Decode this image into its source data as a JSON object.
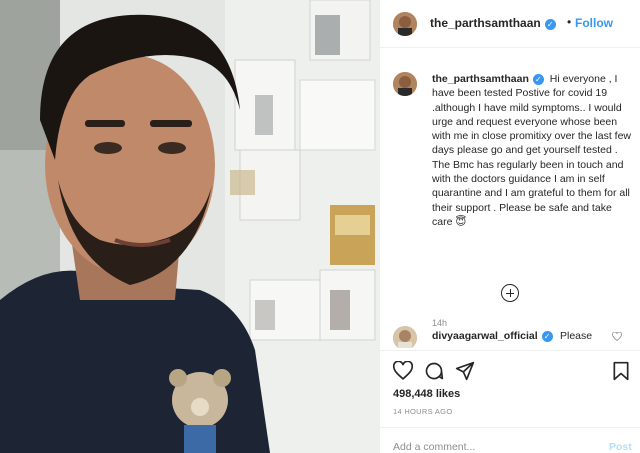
{
  "post": {
    "username": "the_parthsamthaan",
    "follow_label": "Follow",
    "header_separator": "•",
    "caption": "Hi everyone , I have been tested Postive for covid 19 .although I have mild symptoms.. I would urge and request everyone whose been with me in close promitixy over the last few days please go and get yourself tested . The Bmc has regularly been in touch and with the doctors guidance I am in self quarantine and I am grateful to them for all their support . Please be safe and take care",
    "caption_emoji": "😇",
    "caption_time": "14h",
    "likes": "498,448 likes",
    "time_ago": "14 HOURS AGO",
    "add_comment_placeholder": "Add a comment...",
    "post_label": "Post"
  },
  "comment": {
    "username": "divyaagarwal_official",
    "text": "Please"
  },
  "colors": {
    "accent": "#3897f0",
    "text": "#262626",
    "muted": "#8e8e8e",
    "post_disabled": "#b2dffc"
  },
  "icons": {
    "verified": "verified-badge-icon",
    "load_more": "plus-circle-icon",
    "like": "heart-icon",
    "comment": "comment-icon",
    "share": "paper-plane-icon",
    "save": "bookmark-icon"
  }
}
